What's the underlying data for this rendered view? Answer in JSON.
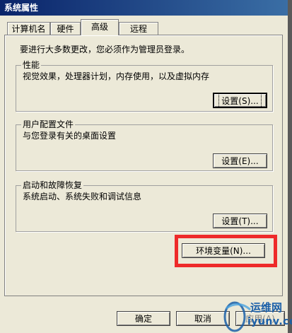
{
  "window": {
    "title": "系统属性"
  },
  "tabs": [
    {
      "label": "计算机名",
      "active": false
    },
    {
      "label": "硬件",
      "active": false
    },
    {
      "label": "高级",
      "active": true
    },
    {
      "label": "远程",
      "active": false
    }
  ],
  "notice": "要进行大多数更改，您必须作为管理员登录。",
  "groups": {
    "performance": {
      "title": "性能",
      "description": "视觉效果，处理器计划，内存使用，以及虚拟内存",
      "button": "设置(S)..."
    },
    "user_profiles": {
      "title": "用户配置文件",
      "description": "与您登录有关的桌面设置",
      "button": "设置(E)..."
    },
    "startup_recovery": {
      "title": "启动和故障恢复",
      "description": "系统启动、系统失败和调试信息",
      "button": "设置(T)..."
    }
  },
  "env_button": "环境变量(N)...",
  "footer": {
    "ok": "确定",
    "cancel": "取消",
    "apply": "应用(A)"
  },
  "watermark": {
    "top": "运维网",
    "bottom": "iyunv.com"
  },
  "colors": {
    "titlebar": "#0a246a",
    "face": "#ece9d8",
    "highlight": "#ee2a2a",
    "watermark": "#1a5fa8"
  }
}
